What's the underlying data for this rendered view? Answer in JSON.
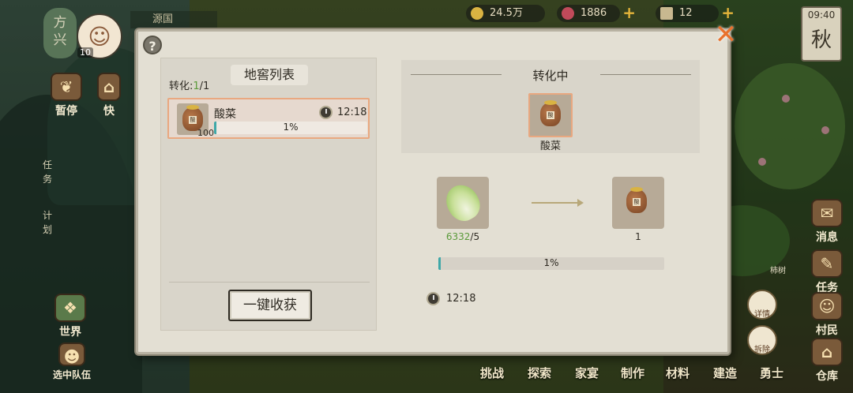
{
  "hud": {
    "region_name": "方兴",
    "player_level": "10",
    "source_name": "源国",
    "coins": "24.5万",
    "gems": "1886",
    "tickets": "12",
    "clock_time": "09:40",
    "season": "秋"
  },
  "left_nav": {
    "pause_label": "暂停",
    "quick_label": "快",
    "task_tab": "任务",
    "plan_tab": "计划",
    "world_label": "世界",
    "team_label": "选中队伍"
  },
  "right_nav": {
    "message_label": "消息",
    "task_label": "任务",
    "villager_label": "村民",
    "warehouse_label": "仓库",
    "detail_label": "详情",
    "demolish_label": "拆除",
    "tree_label": "柿树"
  },
  "bottom_nav": {
    "items": [
      "挑战",
      "探索",
      "家宴",
      "制作",
      "材料",
      "建造",
      "勇士"
    ]
  },
  "dialog": {
    "help_label": "?",
    "close_label": "✕",
    "cellar_list_title": "地窖列表",
    "convert_prefix": "转化:",
    "convert_current": "1",
    "convert_total": "/1",
    "item": {
      "name": "酸菜",
      "qty": "100",
      "timer": "12:18",
      "progress_text": "1%",
      "progress": 0.01,
      "jar_char": "酸"
    },
    "harvest_button": "一键收获",
    "converting_title": "转化中",
    "converting_item_name": "酸菜",
    "input_count_have": "6332",
    "input_count_need": "/5",
    "output_count": "1",
    "main_progress_text": "1%",
    "main_progress": 0.01,
    "main_timer": "12:18"
  },
  "colors": {
    "accent_orange": "#e8722e",
    "progress_teal": "#3fa8a8",
    "highlight_border": "#e9a880",
    "count_green": "#5a9a3a"
  }
}
